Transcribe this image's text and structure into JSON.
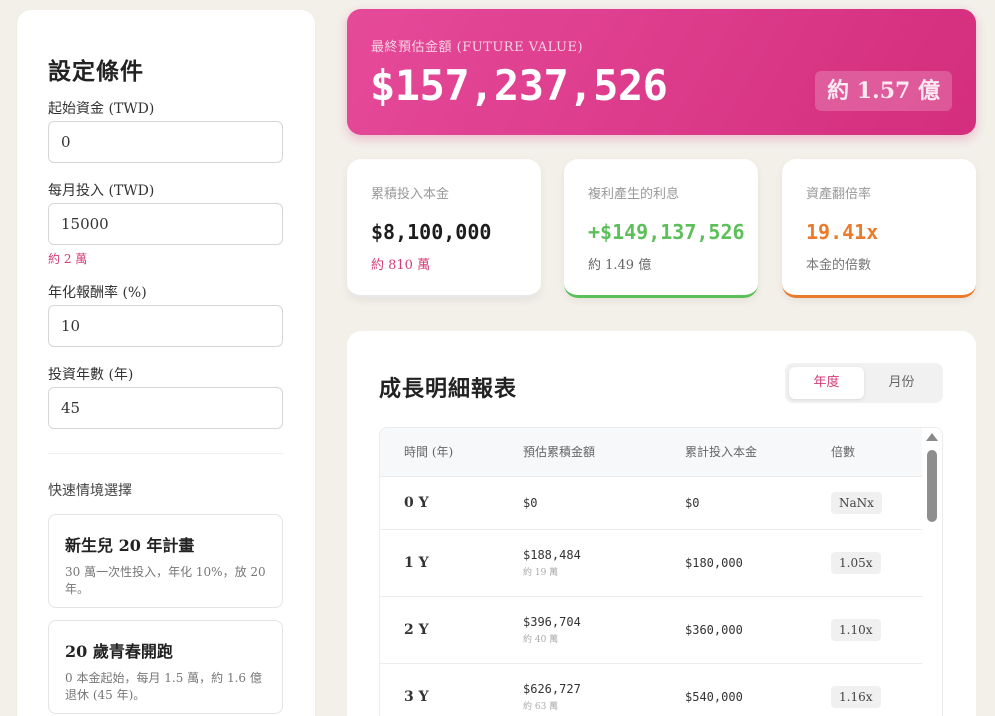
{
  "settings": {
    "title": "設定條件",
    "fields": [
      {
        "label": "起始資金 (TWD)",
        "value": "0"
      },
      {
        "label": "每月投入 (TWD)",
        "value": "15000",
        "hint": "約 2 萬"
      },
      {
        "label": "年化報酬率 (%)",
        "value": "10"
      },
      {
        "label": "投資年數 (年)",
        "value": "45"
      }
    ],
    "quick_title": "快速情境選擇",
    "scenarios": [
      {
        "title": "新生兒 20 年計畫",
        "desc": "30 萬一次性投入，年化 10%，放 20 年。"
      },
      {
        "title": "20 歲青春開跑",
        "desc": "0 本金起始，每月 1.5 萬，約 1.6 億退休 (45 年)。"
      }
    ]
  },
  "hero": {
    "label": "最終預估金額 (FUTURE VALUE)",
    "value": "$157,237,526",
    "badge": "約 1.57 億"
  },
  "stats": [
    {
      "label": "累積投入本金",
      "value": "$8,100,000",
      "sub": "約 810 萬"
    },
    {
      "label": "複利產生的利息",
      "value": "+$149,137,526",
      "sub": "約 1.49 億"
    },
    {
      "label": "資產翻倍率",
      "value": "19.41x",
      "sub": "本金的倍數"
    }
  ],
  "report": {
    "title": "成長明細報表",
    "toggle": [
      "年度",
      "月份"
    ],
    "active_toggle": "年度",
    "columns": [
      "時間 (年)",
      "預估累積金額",
      "累計投入本金",
      "倍數"
    ],
    "rows": [
      {
        "year": "0 Y",
        "amount": "$0",
        "approx": "",
        "principal": "$0",
        "ratio": "NaNx"
      },
      {
        "year": "1 Y",
        "amount": "$188,484",
        "approx": "約 19 萬",
        "principal": "$180,000",
        "ratio": "1.05x"
      },
      {
        "year": "2 Y",
        "amount": "$396,704",
        "approx": "約 40 萬",
        "principal": "$360,000",
        "ratio": "1.10x"
      },
      {
        "year": "3 Y",
        "amount": "$626,727",
        "approx": "約 63 萬",
        "principal": "$540,000",
        "ratio": "1.16x"
      }
    ]
  },
  "colors": {
    "accent_pink": "#d42d7d",
    "green": "#5cbf5a",
    "orange": "#ec7a2b",
    "background": "#f3efe9"
  }
}
